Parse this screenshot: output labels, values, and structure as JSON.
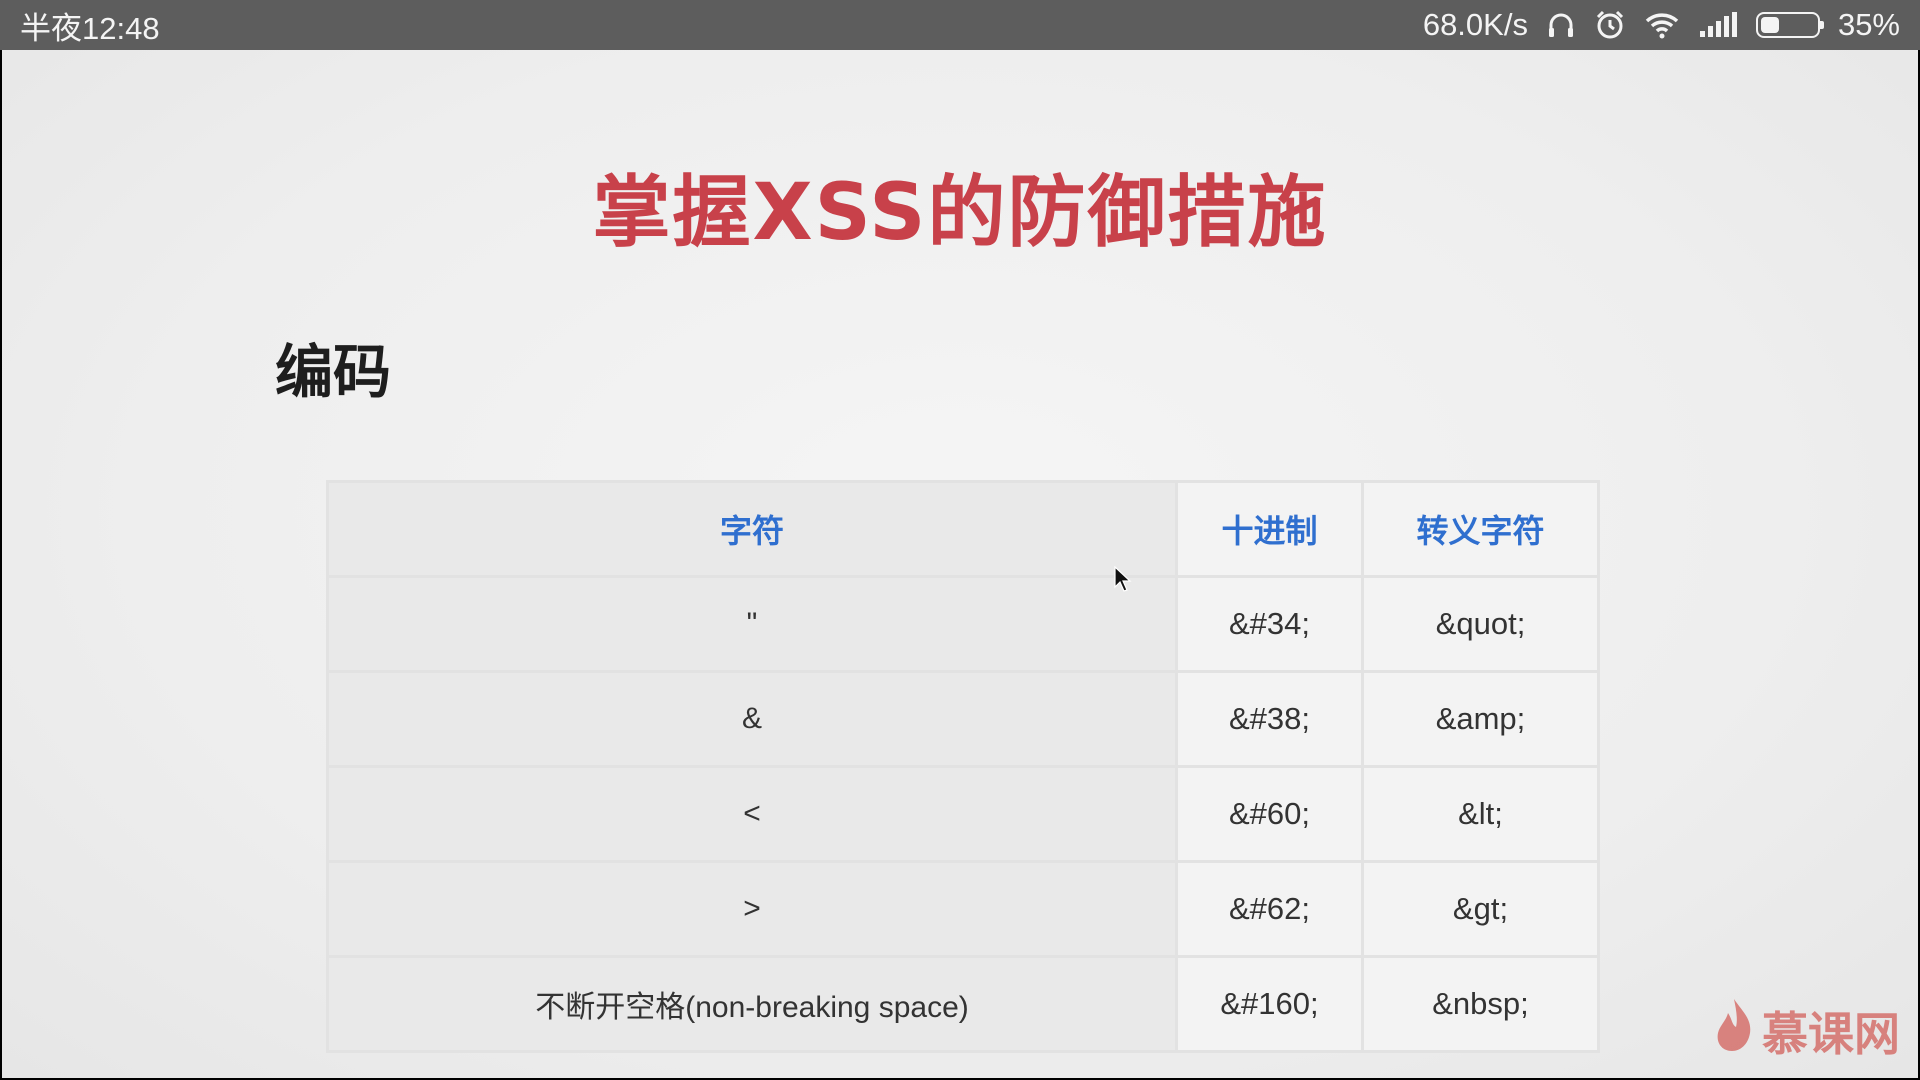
{
  "status_bar": {
    "time": "半夜12:48",
    "network_speed": "68.0K/s",
    "battery_percent": "35%",
    "battery_level": 0.35,
    "icons": [
      "headphones-icon",
      "alarm-icon",
      "wifi-icon",
      "signal-icon",
      "battery-icon"
    ]
  },
  "slide": {
    "title": "掌握XSS的防御措施",
    "section": "编码",
    "table": {
      "headers": [
        "字符",
        "十进制",
        "转义字符"
      ],
      "rows": [
        [
          "\"",
          "&#34;",
          "&quot;"
        ],
        [
          "&",
          "&#38;",
          "&amp;"
        ],
        [
          "<",
          "&#60;",
          "&lt;"
        ],
        [
          ">",
          "&#62;",
          "&gt;"
        ],
        [
          "不断开空格(non-breaking space)",
          "&#160;",
          "&nbsp;"
        ]
      ]
    }
  },
  "watermark": {
    "text": "慕课网",
    "icon": "flame-logo-icon"
  },
  "colors": {
    "title": "#c8414a",
    "header_text": "#2f6fcf",
    "status_bar_bg": "#5d5d5d"
  }
}
